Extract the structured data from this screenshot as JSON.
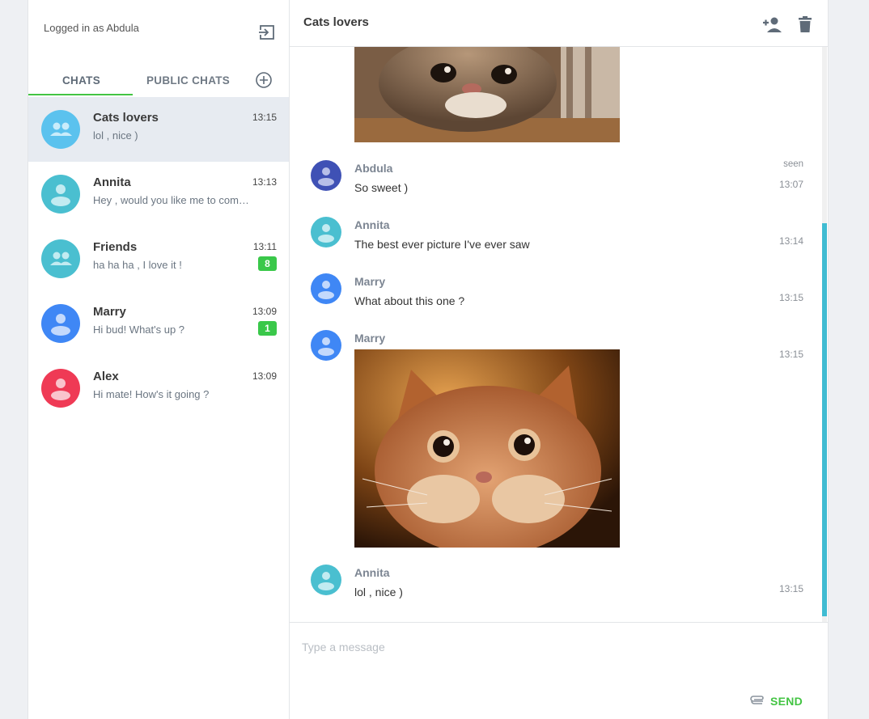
{
  "sidebar": {
    "logged_in_text": "Logged in as Abdula",
    "tabs": {
      "chats": "CHATS",
      "public_chats": "PUBLIC CHATS"
    },
    "chats": [
      {
        "name": "Cats lovers",
        "time": "13:15",
        "preview": "lol , nice )",
        "badge": "",
        "avatar_color": "#5bc2ee",
        "avatar_icon": "group-icon",
        "active": true
      },
      {
        "name": "Annita",
        "time": "13:13",
        "preview": "Hey , would you like me to come to your place tonight?",
        "badge": "",
        "avatar_color": "#4abfd0",
        "avatar_icon": "person-icon"
      },
      {
        "name": "Friends",
        "time": "13:11",
        "preview": "ha ha ha , I love it !",
        "badge": "8",
        "avatar_color": "#4abfd0",
        "avatar_icon": "group-icon"
      },
      {
        "name": "Marry",
        "time": "13:09",
        "preview": "Hi bud! What's up ?",
        "badge": "1",
        "avatar_color": "#3f87f5",
        "avatar_icon": "person-icon"
      },
      {
        "name": "Alex",
        "time": "13:09",
        "preview": "Hi mate! How's it going ?",
        "badge": "",
        "avatar_color": "#ef3a55",
        "avatar_icon": "person-icon"
      }
    ]
  },
  "chat": {
    "title": "Cats lovers",
    "messages": [
      {
        "author": "Abdula",
        "text": "So sweet )",
        "time": "13:07",
        "status": "seen",
        "avatar_color": "#3f51b5"
      },
      {
        "author": "Annita",
        "text": "The best ever picture I've ever saw",
        "time": "13:14",
        "avatar_color": "#4abfd0"
      },
      {
        "author": "Marry",
        "text": "What about this one ?",
        "time": "13:15",
        "avatar_color": "#3f87f5"
      },
      {
        "author": "Marry",
        "text": "",
        "time": "13:15",
        "avatar_color": "#3f87f5",
        "image": "cat-photo"
      },
      {
        "author": "Annita",
        "text": "lol , nice )",
        "time": "13:15",
        "avatar_color": "#4abfd0"
      }
    ],
    "composer": {
      "placeholder": "Type a message",
      "send_label": "SEND"
    }
  },
  "colors": {
    "accent": "#43c443",
    "scrollbar": "#40bcd2",
    "active_row": "#e7ebf1"
  }
}
